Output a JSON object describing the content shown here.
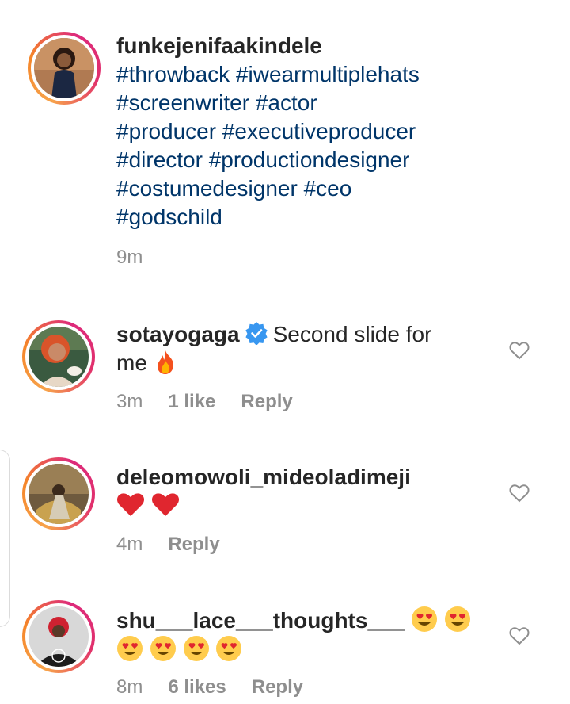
{
  "caption": {
    "username": "funkejenifaakindele",
    "hashtags": [
      "#throwback #iwearmultiplehats",
      "#screenwriter #actor",
      "#producer #executiveproducer",
      "#director #productiondesigner",
      "#costumedesigner #ceo",
      "#godschild"
    ],
    "time": "9m"
  },
  "comments": [
    {
      "username": "sotayogaga",
      "verified": true,
      "text_line1": "Second slide for",
      "text_line2": "me",
      "emoji": "fire-emoji",
      "time": "3m",
      "likes": "1 like",
      "reply": "Reply"
    },
    {
      "username": "deleomowoli_mideoladimeji",
      "emoji": "red-heart-emoji x2",
      "time": "4m",
      "reply": "Reply"
    },
    {
      "username": "shu___lace___thoughts___",
      "emoji": "heart-eyes-emoji x6",
      "time": "8m",
      "likes": "6 likes",
      "reply": "Reply"
    }
  ],
  "colors": {
    "hashtag": "#003569",
    "meta": "#8e8e8e",
    "divider": "#dbdbdb",
    "verified": "#3897f0",
    "heart_red": "#e0262f"
  }
}
